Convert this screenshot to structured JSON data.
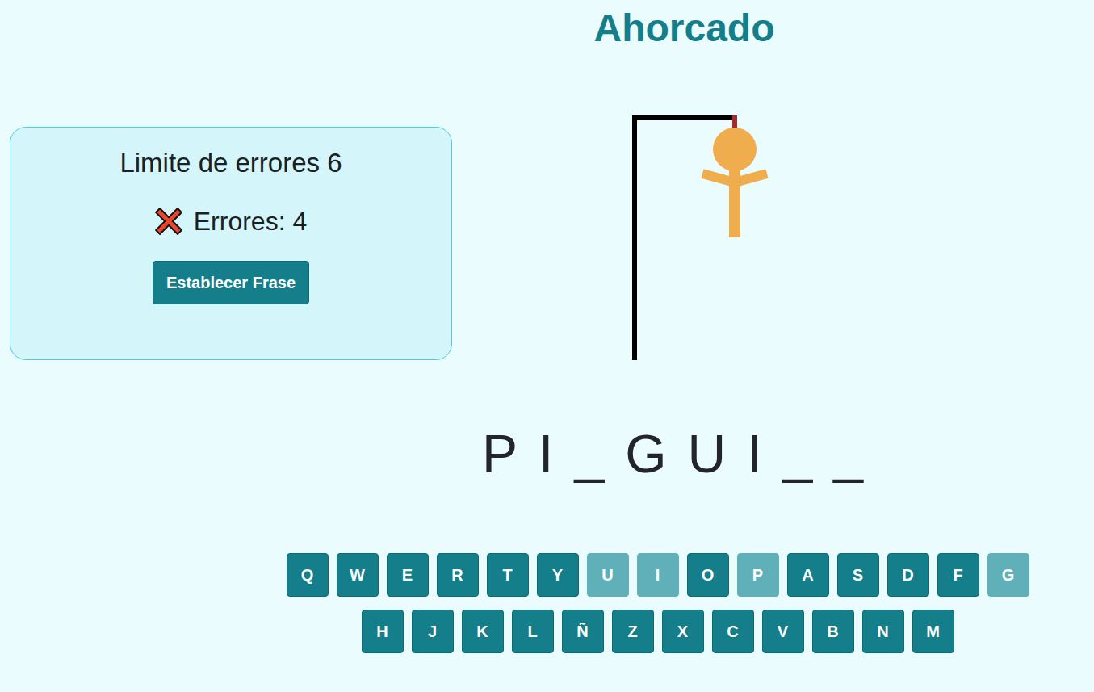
{
  "title": "Ahorcado",
  "panel": {
    "limit_label": "Limite de errores 6",
    "errors_label": "Errores: 4",
    "button": "Establecer Frase"
  },
  "figure": {
    "head": true,
    "body": true,
    "left_arm": true,
    "right_arm": true,
    "left_leg": false,
    "right_leg": false
  },
  "word": [
    "P",
    "I",
    "_",
    "G",
    "U",
    "I",
    "_",
    "_"
  ],
  "keyboard": [
    [
      {
        "label": "Q",
        "used": false
      },
      {
        "label": "W",
        "used": false
      },
      {
        "label": "E",
        "used": false
      },
      {
        "label": "R",
        "used": false
      },
      {
        "label": "T",
        "used": false
      },
      {
        "label": "Y",
        "used": false
      },
      {
        "label": "U",
        "used": true
      },
      {
        "label": "I",
        "used": true
      },
      {
        "label": "O",
        "used": false
      },
      {
        "label": "P",
        "used": true
      },
      {
        "label": "A",
        "used": false
      },
      {
        "label": "S",
        "used": false
      },
      {
        "label": "D",
        "used": false
      },
      {
        "label": "F",
        "used": false
      },
      {
        "label": "G",
        "used": true
      }
    ],
    [
      {
        "label": "H",
        "used": false
      },
      {
        "label": "J",
        "used": false
      },
      {
        "label": "K",
        "used": false
      },
      {
        "label": "L",
        "used": false
      },
      {
        "label": "Ñ",
        "used": false
      },
      {
        "label": "Z",
        "used": false
      },
      {
        "label": "X",
        "used": false
      },
      {
        "label": "C",
        "used": false
      },
      {
        "label": "V",
        "used": false
      },
      {
        "label": "B",
        "used": false
      },
      {
        "label": "N",
        "used": false
      },
      {
        "label": "M",
        "used": false
      }
    ]
  ]
}
